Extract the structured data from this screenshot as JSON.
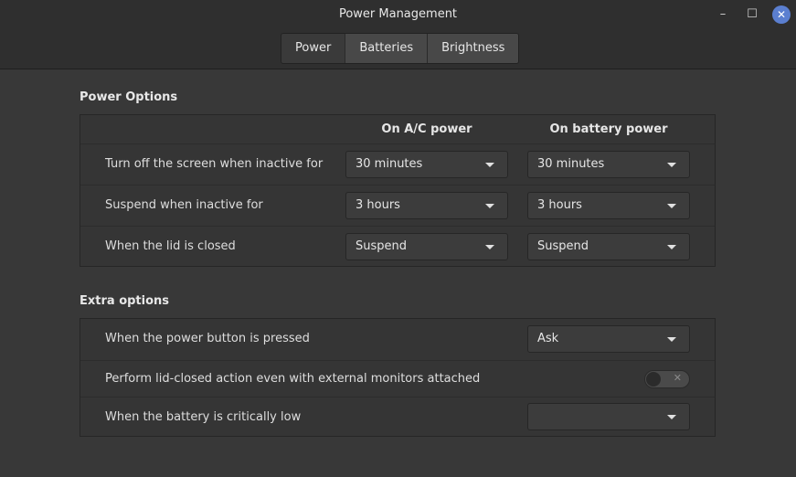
{
  "window": {
    "title": "Power Management",
    "minimize_glyph": "–",
    "maximize_glyph": "☐",
    "close_glyph": "✕",
    "accent_close": "#5b7fd0"
  },
  "tabs": [
    {
      "label": "Power",
      "active": true
    },
    {
      "label": "Batteries",
      "active": false
    },
    {
      "label": "Brightness",
      "active": false
    }
  ],
  "power_options": {
    "title": "Power Options",
    "col_ac": "On A/C power",
    "col_battery": "On battery power",
    "rows": [
      {
        "label": "Turn off the screen when inactive for",
        "ac": "30 minutes",
        "battery": "30 minutes"
      },
      {
        "label": "Suspend when inactive for",
        "ac": "3 hours",
        "battery": "3 hours"
      },
      {
        "label": "When the lid is closed",
        "ac": "Suspend",
        "battery": "Suspend"
      }
    ]
  },
  "extra_options": {
    "title": "Extra options",
    "rows": [
      {
        "label": "When the power button is pressed",
        "value": "Ask"
      },
      {
        "label": "Perform lid-closed action even with external monitors attached",
        "toggle_on": false,
        "toggle_glyph": "✕"
      },
      {
        "label": "When the battery is critically low",
        "value": ""
      }
    ]
  }
}
